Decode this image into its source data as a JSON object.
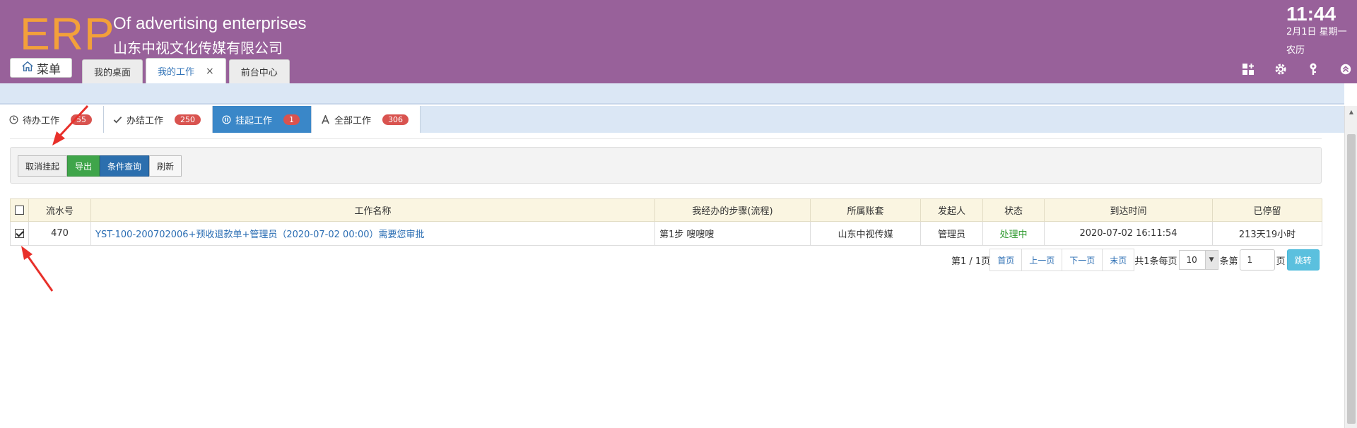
{
  "header": {
    "logo": "ERP",
    "enterprise_en": "Of advertising enterprises",
    "enterprise_cn": "山东中视文化传媒有限公司",
    "time": "11:44",
    "date": "2月1日 星期一",
    "lunar": "农历",
    "menu_label": "菜单",
    "icons": [
      "grid-add-icon",
      "gear-icon",
      "key-icon",
      "collapse-up-icon"
    ]
  },
  "top_tabs": [
    {
      "label": "我的桌面"
    },
    {
      "label": "我的工作",
      "active": true,
      "close": "×"
    },
    {
      "label": "前台中心"
    }
  ],
  "sub_tabs": [
    {
      "label": "待办工作",
      "count": "55",
      "icon": "clock-icon"
    },
    {
      "label": "办结工作",
      "count": "250",
      "icon": "check-icon"
    },
    {
      "label": "挂起工作",
      "count": "1",
      "icon": "pause-icon",
      "active": true
    },
    {
      "label": "全部工作",
      "count": "306",
      "icon": "all-icon"
    }
  ],
  "toolbar": {
    "cancel_suspend": "取消挂起",
    "export": "导出",
    "query": "条件查询",
    "refresh": "刷新"
  },
  "table": {
    "columns": [
      "流水号",
      "工作名称",
      "我经办的步骤(流程)",
      "所属账套",
      "发起人",
      "状态",
      "到达时间",
      "已停留"
    ],
    "rows": [
      {
        "checked": true,
        "serial": "470",
        "name": "YST-100-200702006+预收退款单+管理员（2020-07-02 00:00）需要您审批",
        "step": "第1步 嗖嗖嗖",
        "account": "山东中视传媒",
        "initiator": "管理员",
        "status": "处理中",
        "arrival": "2020-07-02 16:11:54",
        "stayed": "213天19小时"
      }
    ]
  },
  "pager": {
    "page_info": "第1 / 1页",
    "first": "首页",
    "prev": "上一页",
    "next": "下一页",
    "last": "末页",
    "total": "共1条每页",
    "per_page": "10",
    "unit": "条第",
    "page_input": "1",
    "page_suffix": "页",
    "go": "跳转"
  },
  "colors": {
    "header_bg": "#98619a",
    "logo": "#f3a03a",
    "active_tab": "#3a87c8",
    "badge": "#d9534f",
    "export_btn": "#3fa54a",
    "query_btn": "#2c6fae",
    "status_green": "#2e9a2e",
    "go_btn": "#5bc0de"
  }
}
